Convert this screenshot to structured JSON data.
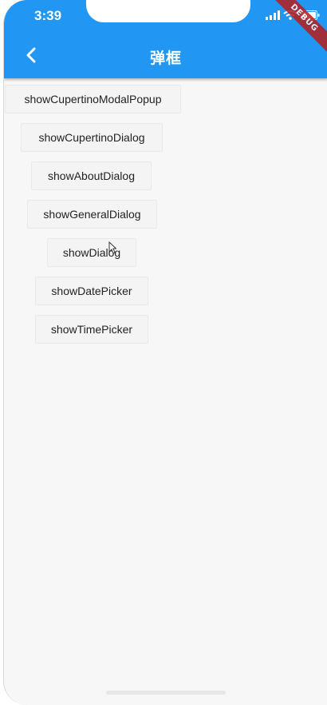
{
  "status_bar": {
    "time": "3:39",
    "icons": [
      "signal-icon",
      "wifi-icon",
      "battery-icon"
    ]
  },
  "appbar": {
    "title": "弹框",
    "back_icon": "chevron-left-icon",
    "color": "#2196F3"
  },
  "debug_banner": "DEBUG",
  "buttons": [
    {
      "label": "showCupertinoModalPopup"
    },
    {
      "label": "showCupertinoDialog"
    },
    {
      "label": "showAboutDialog"
    },
    {
      "label": "showGeneralDialog"
    },
    {
      "label": "showDialog"
    },
    {
      "label": "showDatePicker"
    },
    {
      "label": "showTimePicker"
    }
  ]
}
